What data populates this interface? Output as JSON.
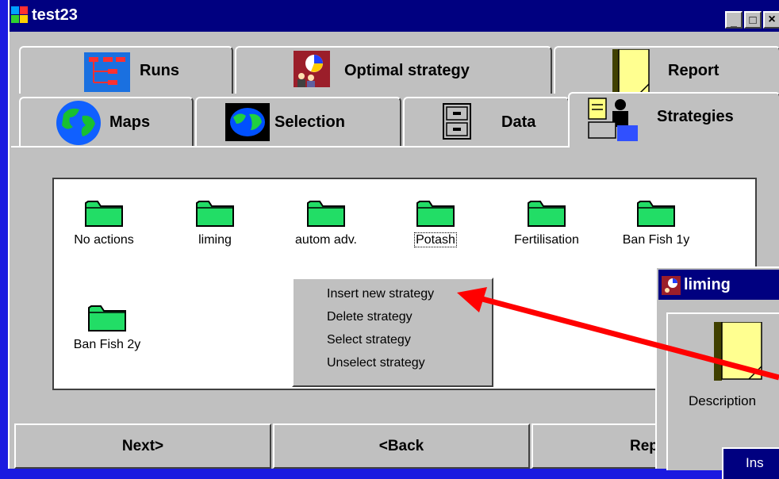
{
  "window": {
    "title": "test23",
    "controls": [
      "_",
      "□",
      "×"
    ]
  },
  "tabs": {
    "back_row": [
      {
        "label": "Runs",
        "icon": "runs-tree-icon"
      },
      {
        "label": "Optimal strategy",
        "icon": "optimal-strategy-icon"
      },
      {
        "label": "Report",
        "icon": "report-notepad-icon"
      }
    ],
    "front_row": [
      {
        "label": "Maps",
        "icon": "globe-icon"
      },
      {
        "label": "Selection",
        "icon": "selection-globe-icon"
      },
      {
        "label": "Data",
        "icon": "filing-cabinet-icon"
      },
      {
        "label": "Strategies",
        "icon": "strategies-computer-icon"
      }
    ],
    "active": "Strategies"
  },
  "strategies": [
    {
      "label": "No actions"
    },
    {
      "label": "liming"
    },
    {
      "label": "autom adv."
    },
    {
      "label": "Potash"
    },
    {
      "label": "Fertilisation"
    },
    {
      "label": "Ban Fish 1y"
    },
    {
      "label": "Ban Fish 2y"
    }
  ],
  "context_menu": {
    "items": [
      "Insert new strategy",
      "Delete strategy",
      "Select strategy",
      "Unselect strategy"
    ]
  },
  "buttons": {
    "next": "Next>",
    "back": "<Back",
    "report": "Rep"
  },
  "popup": {
    "title": "liming",
    "description_label": "Description",
    "button_partial": "Ins"
  },
  "colors": {
    "background": "#1a1ae0",
    "title_bar": "#000080",
    "window_face": "#c0c0c0",
    "folder": "#22dd66",
    "arrow": "#ff0000"
  }
}
